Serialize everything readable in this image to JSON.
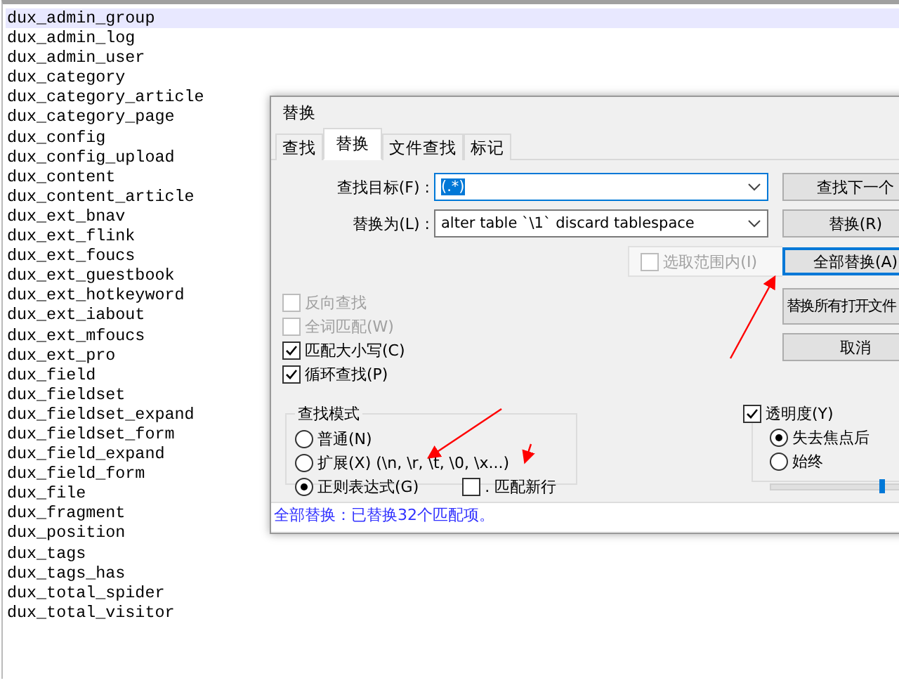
{
  "editor": {
    "lines": [
      {
        "text": "dux_admin_group",
        "selected": true
      },
      {
        "text": "dux_admin_log",
        "selected": false
      },
      {
        "text": "dux_admin_user",
        "selected": false
      },
      {
        "text": "dux_category",
        "selected": false
      },
      {
        "text": "dux_category_article",
        "selected": false
      },
      {
        "text": "dux_category_page",
        "selected": false
      },
      {
        "text": "dux_config",
        "selected": false
      },
      {
        "text": "dux_config_upload",
        "selected": false
      },
      {
        "text": "dux_content",
        "selected": false
      },
      {
        "text": "dux_content_article",
        "selected": false
      },
      {
        "text": "dux_ext_bnav",
        "selected": false
      },
      {
        "text": "dux_ext_flink",
        "selected": false
      },
      {
        "text": "dux_ext_foucs",
        "selected": false
      },
      {
        "text": "dux_ext_guestbook",
        "selected": false
      },
      {
        "text": "dux_ext_hotkeyword",
        "selected": false
      },
      {
        "text": "dux_ext_iabout",
        "selected": false
      },
      {
        "text": "dux_ext_mfoucs",
        "selected": false
      },
      {
        "text": "dux_ext_pro",
        "selected": false
      },
      {
        "text": "dux_field",
        "selected": false
      },
      {
        "text": "dux_fieldset",
        "selected": false
      },
      {
        "text": "dux_fieldset_expand",
        "selected": false
      },
      {
        "text": "dux_fieldset_form",
        "selected": false
      },
      {
        "text": "dux_field_expand",
        "selected": false
      },
      {
        "text": "dux_field_form",
        "selected": false
      },
      {
        "text": "dux_file",
        "selected": false
      },
      {
        "text": "dux_fragment",
        "selected": false
      },
      {
        "text": "dux_position",
        "selected": false
      },
      {
        "text": "dux_tags",
        "selected": false
      },
      {
        "text": "dux_tags_has",
        "selected": false
      },
      {
        "text": "dux_total_spider",
        "selected": false
      },
      {
        "text": "dux_total_visitor",
        "selected": false
      }
    ]
  },
  "dialog": {
    "title": "替换",
    "tabs": [
      {
        "label": "查找",
        "selected": false
      },
      {
        "label": "替换",
        "selected": true
      },
      {
        "label": "文件查找",
        "selected": false
      },
      {
        "label": "标记",
        "selected": false
      }
    ],
    "fields": [
      {
        "label": "查找目标(F) :",
        "value": "(.*)",
        "value_selected": true
      },
      {
        "label": "替换为(L) :",
        "value": "alter table `\\1` discard tablespace",
        "value_selected": false
      }
    ],
    "in_selection": {
      "label": "选取范围内(I)",
      "checked": false,
      "disabled": true
    },
    "buttons": [
      {
        "label": "查找下一个",
        "focused": false
      },
      {
        "label": "替换(R)",
        "focused": false
      },
      {
        "label": "全部替换(A)",
        "focused": true
      },
      {
        "label": "替换所有打开文件",
        "focused": false
      },
      {
        "label": "取消",
        "focused": false
      }
    ],
    "options": [
      {
        "label": "反向查找",
        "checked": false,
        "disabled": true
      },
      {
        "label": "全词匹配(W)",
        "checked": false,
        "disabled": true
      },
      {
        "label": "匹配大小写(C)",
        "checked": true,
        "disabled": false
      },
      {
        "label": "循环查找(P)",
        "checked": true,
        "disabled": false
      }
    ],
    "search_mode": {
      "legend": "查找模式",
      "options": [
        {
          "label": "普通(N)",
          "selected": false
        },
        {
          "label": "扩展(X) (\\n, \\r, \\t, \\0, \\x...)",
          "selected": false
        },
        {
          "label": "正则表达式(G)",
          "selected": true
        }
      ],
      "dot_newline": {
        "label": ". 匹配新行",
        "checked": false
      }
    },
    "transparency": {
      "label": "透明度(Y)",
      "checked": true,
      "options": [
        {
          "label": "失去焦点后",
          "selected": true
        },
        {
          "label": "始终",
          "selected": false
        }
      ],
      "level": 0.7
    },
    "status": "全部替换：已替换32个匹配项。"
  }
}
